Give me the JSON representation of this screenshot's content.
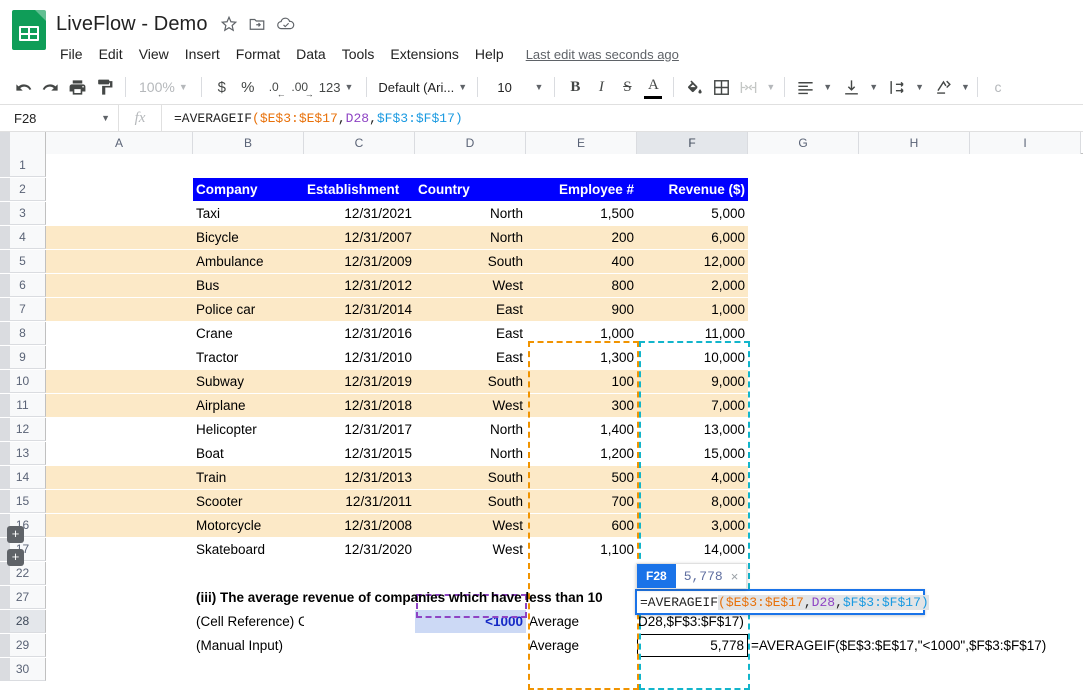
{
  "app": {
    "doc_title": "LiveFlow - Demo",
    "logo_name": "sheets-logo",
    "title_icons": [
      "star-icon",
      "move-to-folder-icon",
      "cloud-saved-icon"
    ],
    "menu": [
      "File",
      "Edit",
      "View",
      "Insert",
      "Format",
      "Data",
      "Tools",
      "Extensions",
      "Help"
    ],
    "last_edit": "Last edit was seconds ago"
  },
  "toolbar": {
    "undo": "undo-icon",
    "redo": "redo-icon",
    "print": "print-icon",
    "paint": "paint-format-icon",
    "zoom": "100%",
    "currency": "$",
    "percent": "%",
    "decrease_decimal": ".0",
    "increase_decimal": ".00",
    "number_format": "123",
    "font": "Default (Ari...",
    "font_size": "10",
    "bold": "B",
    "italic": "I",
    "strikethrough": "S",
    "text_color": "A",
    "fill_color": "fill-color-icon",
    "borders": "borders-icon",
    "merge": "merge-cells-icon",
    "halign": "horizontal-align-icon",
    "valign": "vertical-align-icon",
    "wrap": "text-wrap-icon",
    "rotate": "text-rotation-icon"
  },
  "formula_bar": {
    "name_box": "F28",
    "fx": "fx",
    "formula_plain": "=AVERAGEIF($E$3:$E$17,D28,$F$3:$F$17)",
    "tokens": {
      "fn": "=AVERAGEIF",
      "open": "(",
      "range1": "$E$3:$E$17",
      "comma1": ",",
      "criterion": "D28",
      "comma2": ",",
      "range2": "$F$3:$F$17",
      "close": ")"
    }
  },
  "grid": {
    "columns": [
      "A",
      "B",
      "C",
      "D",
      "E",
      "F",
      "G",
      "H",
      "I"
    ],
    "selected_column": "F",
    "rows": [
      "1",
      "2",
      "3",
      "4",
      "5",
      "6",
      "7",
      "8",
      "9",
      "10",
      "11",
      "12",
      "13",
      "14",
      "15",
      "16",
      "17",
      "22",
      "27",
      "28",
      "29",
      "30"
    ],
    "selected_row": "28",
    "expanders": [
      "+",
      "+"
    ]
  },
  "table": {
    "headers": [
      "Company",
      "Establishment",
      "Country",
      "Employee #",
      "Revenue ($)"
    ],
    "rows": [
      {
        "company": "Taxi",
        "establishment": "12/31/2021",
        "country": "North",
        "employees": "1,500",
        "revenue": "5,000",
        "highlight": false
      },
      {
        "company": "Bicycle",
        "establishment": "12/31/2007",
        "country": "North",
        "employees": "200",
        "revenue": "6,000",
        "highlight": true
      },
      {
        "company": "Ambulance",
        "establishment": "12/31/2009",
        "country": "South",
        "employees": "400",
        "revenue": "12,000",
        "highlight": true
      },
      {
        "company": "Bus",
        "establishment": "12/31/2012",
        "country": "West",
        "employees": "800",
        "revenue": "2,000",
        "highlight": true
      },
      {
        "company": "Police car",
        "establishment": "12/31/2014",
        "country": "East",
        "employees": "900",
        "revenue": "1,000",
        "highlight": true
      },
      {
        "company": "Crane",
        "establishment": "12/31/2016",
        "country": "East",
        "employees": "1,000",
        "revenue": "11,000",
        "highlight": false
      },
      {
        "company": "Tractor",
        "establishment": "12/31/2010",
        "country": "East",
        "employees": "1,300",
        "revenue": "10,000",
        "highlight": false
      },
      {
        "company": "Subway",
        "establishment": "12/31/2019",
        "country": "South",
        "employees": "100",
        "revenue": "9,000",
        "highlight": true
      },
      {
        "company": "Airplane",
        "establishment": "12/31/2018",
        "country": "West",
        "employees": "300",
        "revenue": "7,000",
        "highlight": true
      },
      {
        "company": "Helicopter",
        "establishment": "12/31/2017",
        "country": "North",
        "employees": "1,400",
        "revenue": "13,000",
        "highlight": false
      },
      {
        "company": "Boat",
        "establishment": "12/31/2015",
        "country": "North",
        "employees": "1,200",
        "revenue": "15,000",
        "highlight": false
      },
      {
        "company": "Train",
        "establishment": "12/31/2013",
        "country": "South",
        "employees": "500",
        "revenue": "4,000",
        "highlight": true
      },
      {
        "company": "Scooter",
        "establishment": "12/31/2011",
        "country": "South",
        "employees": "700",
        "revenue": "8,000",
        "highlight": true
      },
      {
        "company": "Motorcycle",
        "establishment": "12/31/2008",
        "country": "West",
        "employees": "600",
        "revenue": "3,000",
        "highlight": true
      },
      {
        "company": "Skateboard",
        "establishment": "12/31/2020",
        "country": "West",
        "employees": "1,100",
        "revenue": "14,000",
        "highlight": false
      }
    ]
  },
  "bottom": {
    "question": "(iii) The average revenue of companies which have less than 10",
    "label_cell_ref": "(Cell Reference) Criterion",
    "label_manual": "(Manual Input)",
    "criterion_value": "<1000",
    "average_label_1": "Average",
    "average_label_2": "Average",
    "manual_result": "5,778",
    "behind_formula_text": "D28,$F$3:$F$17)",
    "manual_formula_text": "=AVERAGEIF($E$3:$E$17,\"<1000\",$F$3:$F$17)"
  },
  "editor": {
    "tip_ref": "F28",
    "tip_value": "5,778",
    "tip_close": "×",
    "formula": "=AVERAGEIF($E$3:$E$17,D28,$F$3:$F$17)"
  },
  "colors": {
    "header_blue": "#0000ff",
    "highlight_cream": "#fce9c7",
    "range1_orange": "#e8710a",
    "criterion_purple": "#8e44c4",
    "range2_blue": "#1a9ae1",
    "accent": "#1a73e8",
    "sheets_green": "#0f9d58"
  }
}
